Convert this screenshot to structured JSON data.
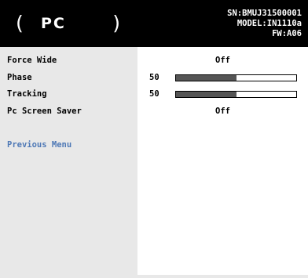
{
  "header": {
    "paren_left": "(",
    "title": "PC",
    "paren_right": ")",
    "serial": "SN:BMUJ31500001",
    "model": "MODEL:IN1110a",
    "firmware": "FW:A06"
  },
  "menu": {
    "items": [
      {
        "label": "Force Wide",
        "value": "Off"
      },
      {
        "label": "Phase",
        "value": "50",
        "level_percent": 50
      },
      {
        "label": "Tracking",
        "value": "50",
        "level_percent": 50
      },
      {
        "label": "Pc Screen Saver",
        "value": "Off"
      }
    ],
    "previous_menu": "Previous Menu"
  },
  "colors": {
    "header_bg": "#000000",
    "left_panel_bg": "#e8e8e8",
    "bar_fill": "#555555",
    "previous_menu_text": "#4f79b6"
  }
}
